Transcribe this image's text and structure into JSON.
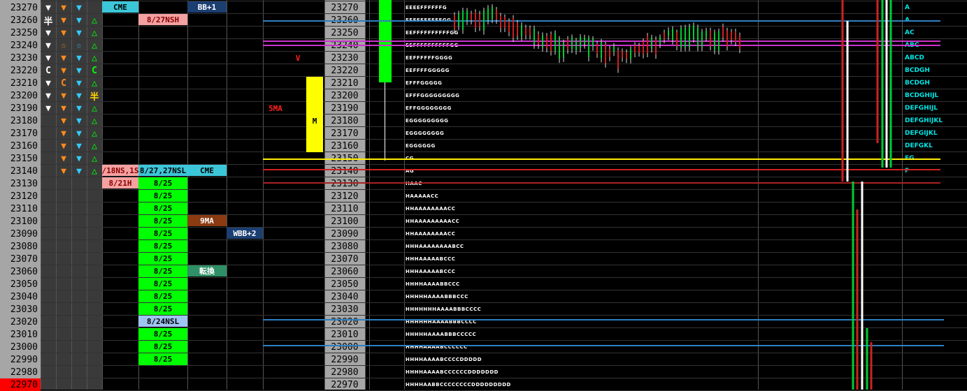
{
  "colors": {
    "price_bg": "#a6a6a6",
    "current_bg": "#ff0000",
    "green": "#00ff00",
    "pink": "#f4a1a1",
    "cyan_bg": "#3cc6d9",
    "navy_bg": "#1c3f72",
    "brown_bg": "#8a3b12",
    "teal_bg": "#2f8f66",
    "lightblue_bg": "#9ec4f2",
    "yellow_bg": "#ffff00"
  },
  "prices": [
    "23270",
    "23260",
    "23250",
    "23240",
    "23230",
    "23220",
    "23210",
    "23200",
    "23190",
    "23180",
    "23170",
    "23160",
    "23150",
    "23140",
    "23130",
    "23120",
    "23110",
    "23100",
    "23090",
    "23080",
    "23070",
    "23060",
    "23050",
    "23040",
    "23030",
    "23020",
    "23010",
    "23000",
    "22990",
    "22980",
    "22970"
  ],
  "current_price": "22970",
  "markers": {
    "col_white": [
      "tri-down",
      "kanji-han",
      "tri-down",
      "tri-down",
      "tri-down",
      "C",
      "tri-down",
      "tri-down",
      "tri-down",
      "",
      "",
      "",
      "",
      "",
      "",
      "",
      "",
      "",
      "",
      "",
      "",
      "",
      "",
      "",
      "",
      "",
      "",
      "",
      "",
      "",
      ""
    ],
    "col_orange": [
      "tri-down",
      "tri-down",
      "tri-down",
      "star",
      "tri-down",
      "tri-down",
      "C",
      "tri-down",
      "tri-down",
      "tri-down",
      "tri-down",
      "tri-down",
      "tri-down",
      "tri-down",
      "",
      "",
      "",
      "",
      "",
      "",
      "",
      "",
      "",
      "",
      "",
      "",
      "",
      "",
      "",
      "",
      ""
    ],
    "col_cyan": [
      "tri-down",
      "tri-down",
      "tri-down",
      "star",
      "tri-down",
      "tri-down",
      "tri-down",
      "tri-down",
      "tri-down",
      "tri-down",
      "tri-down",
      "tri-down",
      "tri-down",
      "tri-down",
      "",
      "",
      "",
      "",
      "",
      "",
      "",
      "",
      "",
      "",
      "",
      "",
      "",
      "",
      "",
      "",
      ""
    ],
    "col_green": [
      "",
      "tri-up",
      "tri-up",
      "tri-up",
      "tri-up",
      "C",
      "tri-up",
      "kanji-han",
      "tri-up",
      "tri-up",
      "tri-up",
      "tri-up",
      "tri-up",
      "tri-up",
      "",
      "",
      "",
      "",
      "",
      "",
      "",
      "",
      "",
      "",
      "",
      "",
      "",
      "",
      "",
      "",
      ""
    ]
  },
  "kanji_han": "半",
  "letter_c": "C",
  "labels": {
    "cme_top": "CME",
    "nsh_827": "8/27NSH",
    "bb_plus1": "BB+1",
    "ns_18": "/18NS,1S",
    "nsl_827": "8/27,27NSL",
    "cme_mid": "CME",
    "h_821": "8/21H",
    "ma9": "9MA",
    "wbb_plus2": "WBB+2",
    "tenkan": "転換",
    "nsl_824": "8/24NSL",
    "ma5": "5MA",
    "v_mark": "V",
    "m_mark": "M"
  },
  "green_dates": [
    "8/25",
    "8/25",
    "8/25",
    "8/25",
    "8/25",
    "8/25",
    "8/25",
    "8/25",
    "8/25",
    "8/25",
    "8/25",
    "8/25",
    "8/25",
    "8/25"
  ],
  "profile_left": [
    "EEEEFFFFFFG",
    "EEEFFFFFFFGG",
    "EEFFFFFFFFFFGG",
    "EEFFFFFFFFFFGG",
    "EEFFFFFFGGGG",
    "EEFFFFGGGGG",
    "EFFFGGGGG",
    "EFFFGGGGGGGGG",
    "EFFGGGGGGGG",
    "EGGGGGGGGG",
    "EGGGGGGGG",
    "EGGGGGG",
    "CG",
    "AG",
    "HAAC",
    "HAAAAACC",
    "HHAAAAAAAACC",
    "HHAAAAAAAAACC",
    "HHAAAAAAAACC",
    "HHHAAAAAAAABCC",
    "HHHAAAAABCCC",
    "HHHAAAAABCCC",
    "HHHHAAAABBCCC",
    "HHHHHAAAABBBCCC",
    "HHHHHHHAAAABBBCCCC",
    "HHHHHHAAAABBBCCCC",
    "HHHHHAAAABBBCCCCC",
    "HHHHAAAABCCCCCC",
    "HHHHAAAABCCCCDDDDD",
    "HHHHAAAABCCCCCCDDDDDDD",
    "HHHHAABBCCCCCCCCDDDDDDDDD"
  ],
  "profile_right": [
    "A",
    "A",
    "AC",
    "ABC",
    "ABCD",
    "BCDGH",
    "BCDGH",
    "BCDGHIJL",
    "DEFGHIJL",
    "DEFGHIJKL",
    "DEFGIJKL",
    "DEFGKL",
    "EG",
    "F",
    "",
    "",
    "",
    "",
    "",
    "",
    "",
    "",
    "",
    "",
    "",
    "",
    "",
    "",
    "",
    "",
    ""
  ]
}
